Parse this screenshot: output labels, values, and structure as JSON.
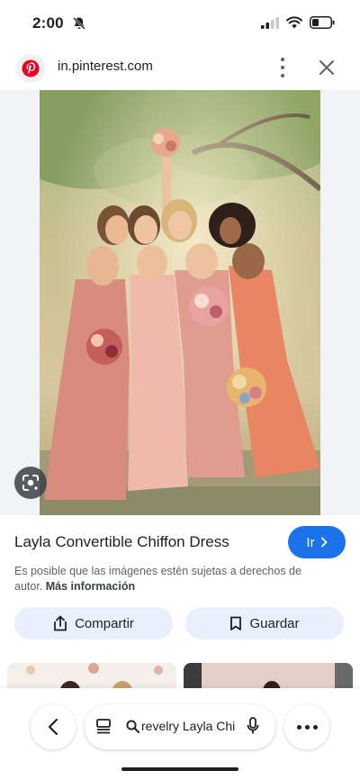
{
  "status_bar": {
    "time": "2:00"
  },
  "address_bar": {
    "url": "in.pinterest.com",
    "favicon": "pinterest-logo"
  },
  "image": {
    "title": "Layla Convertible Chiffon Dress",
    "go_label": "Ir",
    "notice_text": "Es posible que las imágenes estén sujetas a derechos de autor.",
    "more_info_label": "Más información"
  },
  "actions": {
    "share_label": "Compartir",
    "save_label": "Guardar"
  },
  "toolbar": {
    "search_query": "revelry Layla Chi"
  },
  "colors": {
    "accent": "#1a73e8",
    "pill_bg": "#e8f0fe",
    "pinterest_red": "#e60023"
  }
}
